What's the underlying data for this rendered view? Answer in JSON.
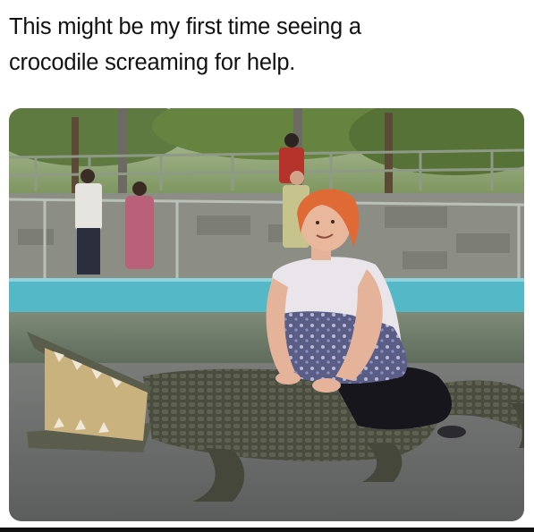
{
  "post": {
    "text_line1": "This might be my first time seeing a",
    "text_line2": "crocodile screaming for help."
  },
  "photo": {
    "scene": "woman-sitting-on-crocodile",
    "colors": {
      "sky_foliage": "#6f8a4e",
      "fence": "#7e8f7a",
      "wall": "#8c8e86",
      "pool_rim": "#55b8c6",
      "water": "#6d7a66",
      "ground": "#6a6c6c",
      "crocodile": "#4a4c40",
      "hair": "#e06a35",
      "top": "#e9e5ea",
      "vest": "#5a5d86",
      "pants": "#16161c"
    }
  }
}
